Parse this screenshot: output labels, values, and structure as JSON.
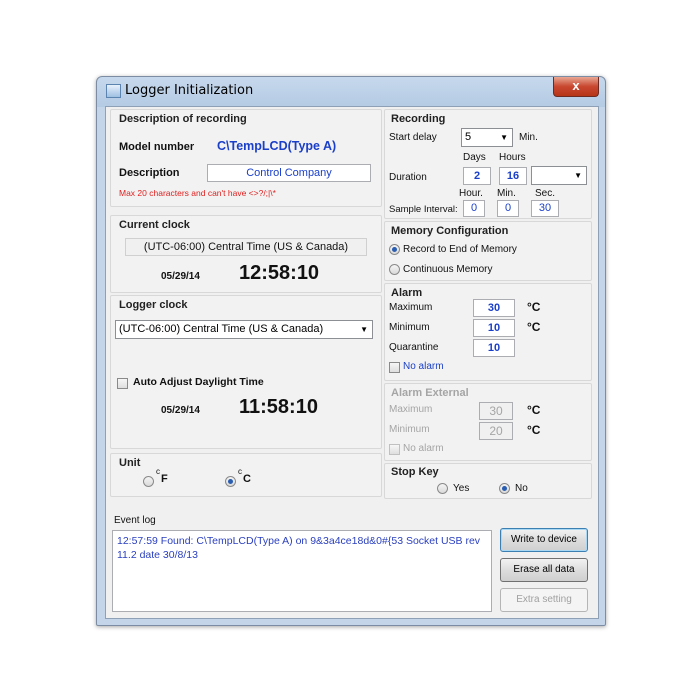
{
  "window": {
    "title": "Logger Initialization",
    "close_label": "x"
  },
  "description_group": {
    "title": "Description of recording",
    "model_label": "Model number",
    "model_value": "C\\TempLCD(Type A)",
    "description_label": "Description",
    "description_value": "Control Company",
    "warning": "Max 20 characters and can't have <>?/;|\\*"
  },
  "current_clock": {
    "title": "Current clock",
    "timezone": "(UTC-06:00) Central Time (US & Canada)",
    "date": "05/29/14",
    "time": "12:58:10"
  },
  "logger_clock": {
    "title": "Logger clock",
    "timezone": "(UTC-06:00) Central Time (US & Canada)",
    "auto_adjust_label": "Auto Adjust Daylight Time",
    "date": "05/29/14",
    "time": "11:58:10"
  },
  "unit": {
    "title": "Unit",
    "f_label": "F",
    "c_label": "C",
    "degree": "c",
    "selected": "C"
  },
  "recording": {
    "title": "Recording",
    "start_delay_label": "Start delay",
    "start_delay_value": "5",
    "start_delay_unit": "Min.",
    "days_label": "Days",
    "hours_label": "Hours",
    "duration_label": "Duration",
    "duration_days": "2",
    "duration_hours": "16",
    "duration_combo": "",
    "hour_label": "Hour.",
    "min_label": "Min.",
    "sec_label": "Sec.",
    "sample_label": "Sample Interval:",
    "sample_hour": "0",
    "sample_min": "0",
    "sample_sec": "30"
  },
  "memory": {
    "title": "Memory Configuration",
    "option1": "Record to End of Memory",
    "option2": "Continuous Memory",
    "selected": "option1"
  },
  "alarm": {
    "title": "Alarm",
    "max_label": "Maximum",
    "max_value": "30",
    "min_label": "Minimum",
    "min_value": "10",
    "quarantine_label": "Quarantine",
    "quarantine_value": "10",
    "unit": "°C",
    "no_alarm_label": "No alarm"
  },
  "alarm_external": {
    "title": "Alarm External",
    "max_label": "Maximum",
    "max_value": "30",
    "min_label": "Minimum",
    "min_value": "20",
    "unit": "°C",
    "no_alarm_label": "No alarm"
  },
  "stop_key": {
    "title": "Stop Key",
    "yes_label": "Yes",
    "no_label": "No",
    "selected": "No"
  },
  "event_log": {
    "title": "Event log",
    "text": "12:57:59 Found: C\\TempLCD(Type A) on 9&3a4ce18d&0#{53 Socket USB rev 11.2 date 30/8/13"
  },
  "buttons": {
    "write": "Write to device",
    "erase": "Erase all data",
    "extra": "Extra setting"
  }
}
